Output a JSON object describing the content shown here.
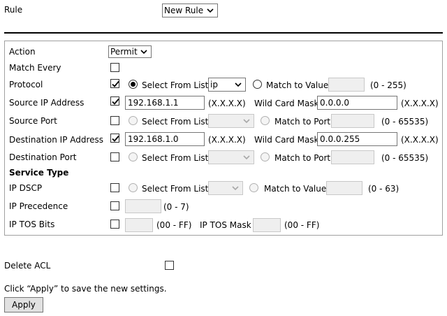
{
  "rule": {
    "label": "Rule",
    "value": "New Rule"
  },
  "form": {
    "action": {
      "label": "Action",
      "value": "Permit"
    },
    "match_every": {
      "label": "Match Every",
      "checked": false
    },
    "protocol": {
      "label": "Protocol",
      "checked": true,
      "select_from_list_label": "Select From List",
      "list_value": "ip",
      "match_to_value_label": "Match to Value",
      "value": "",
      "range": "(0 - 255)"
    },
    "source_ip": {
      "label": "Source IP Address",
      "checked": true,
      "address": "192.168.1.1",
      "format": "(X.X.X.X)",
      "mask_label": "Wild Card Mask",
      "mask": "0.0.0.0",
      "mask_format": "(X.X.X.X)"
    },
    "source_port": {
      "label": "Source Port",
      "checked": false,
      "select_from_list_label": "Select From List",
      "list_value": "",
      "match_to_port_label": "Match to Port",
      "port": "",
      "range": "(0 - 65535)"
    },
    "dest_ip": {
      "label": "Destination IP Address",
      "checked": true,
      "address": "192.168.1.0",
      "format": "(X.X.X.X)",
      "mask_label": "Wild Card Mask",
      "mask": "0.0.0.255",
      "mask_format": "(X.X.X.X)"
    },
    "dest_port": {
      "label": "Destination Port",
      "checked": false,
      "select_from_list_label": "Select From List",
      "list_value": "",
      "match_to_port_label": "Match to Port",
      "port": "",
      "range": "(0 - 65535)"
    },
    "service_type": {
      "heading": "Service Type"
    },
    "ip_dscp": {
      "label": "IP DSCP",
      "checked": false,
      "select_from_list_label": "Select From List",
      "list_value": "",
      "match_to_value_label": "Match to Value",
      "value": "",
      "range": "(0 - 63)"
    },
    "ip_precedence": {
      "label": "IP Precedence",
      "checked": false,
      "value": "",
      "range": "(0 - 7)"
    },
    "ip_tos": {
      "label": "IP TOS Bits",
      "checked": false,
      "value": "",
      "range": "(00 - FF)",
      "mask_label": "IP TOS Mask",
      "mask": "",
      "mask_range": "(00 - FF)"
    }
  },
  "delete_acl": {
    "label": "Delete ACL",
    "checked": false
  },
  "footer": {
    "hint": "Click “Apply” to save the new settings.",
    "apply_label": "Apply"
  },
  "icons": {
    "chevron": "chevron-down-icon",
    "check": "checkmark-icon"
  }
}
